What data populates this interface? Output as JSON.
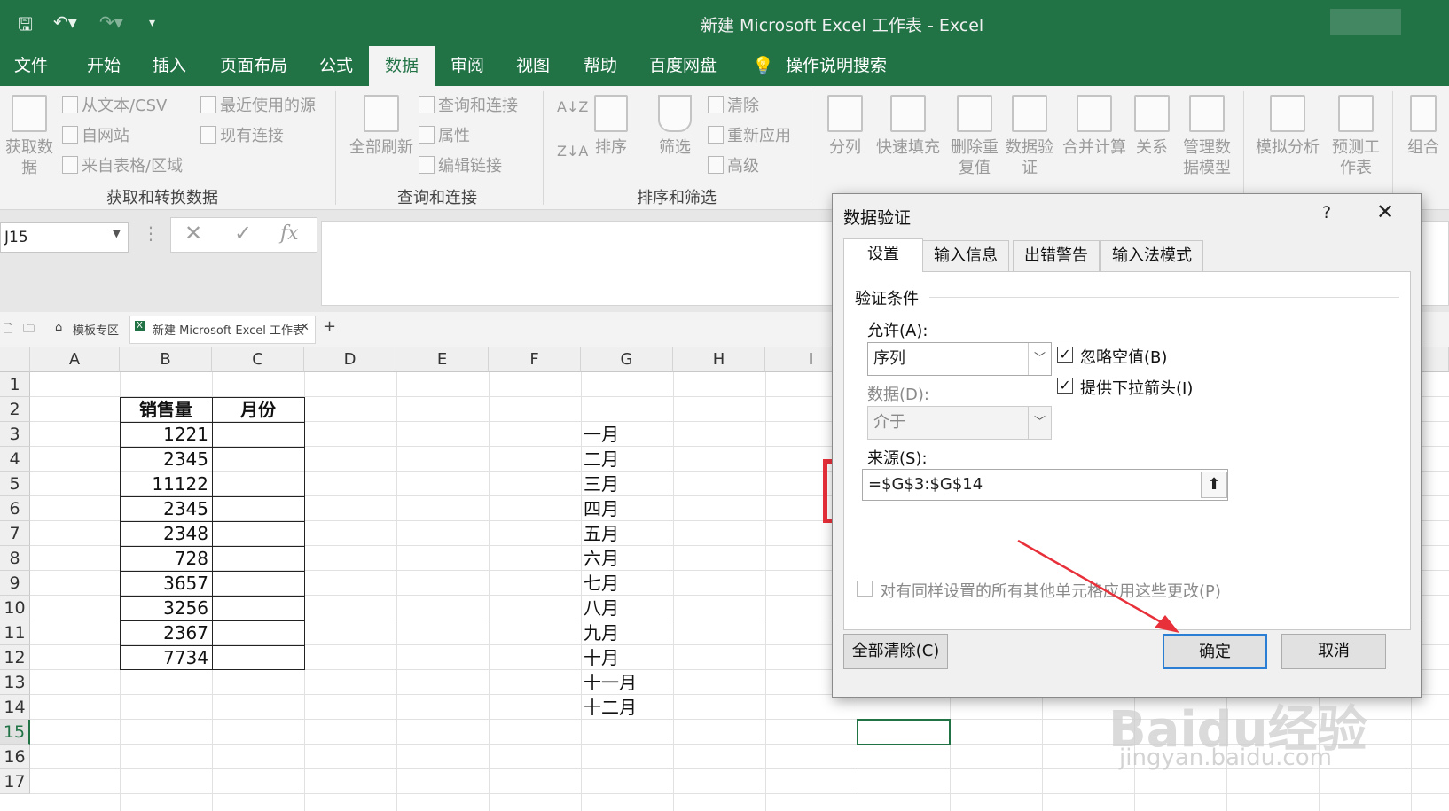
{
  "window": {
    "title": "新建 Microsoft Excel 工作表  -  Excel"
  },
  "ribbon_tabs": [
    "文件",
    "开始",
    "插入",
    "页面布局",
    "公式",
    "数据",
    "审阅",
    "视图",
    "帮助",
    "百度网盘",
    "操作说明搜索"
  ],
  "ribbon": {
    "get_data": "获取数据",
    "from_text": "从文本/CSV",
    "from_web": "自网站",
    "from_table": "来自表格/区域",
    "recent_sources": "最近使用的源",
    "existing_conn": "现有连接",
    "group_get": "获取和转换数据",
    "refresh_all": "全部刷新",
    "queries_conn": "查询和连接",
    "properties": "属性",
    "edit_links": "编辑链接",
    "group_queries": "查询和连接",
    "sort": "排序",
    "filter": "筛选",
    "clear": "清除",
    "reapply": "重新应用",
    "advanced": "高级",
    "group_sort": "排序和筛选",
    "text_to_col": "分列",
    "flash_fill": "快速填充",
    "remove_dup": "删除重复值",
    "data_valid": "数据验证",
    "consolidate": "合并计算",
    "relations": "关系",
    "manage_model": "管理数据模型",
    "what_if": "模拟分析",
    "forecast": "预测工作表",
    "group_label": "组合"
  },
  "formula_bar": {
    "name_box": "J15",
    "cancel": "✕",
    "enter": "✓",
    "fx": "fx",
    "value": ""
  },
  "workbook_tabs": {
    "template": "模板专区",
    "file": "新建 Microsoft Excel 工作表",
    "add": "+"
  },
  "sheet": {
    "columns": [
      "A",
      "B",
      "C",
      "D",
      "E",
      "F",
      "G",
      "H",
      "I"
    ],
    "rows": [
      "1",
      "2",
      "3",
      "4",
      "5",
      "6",
      "7",
      "8",
      "9",
      "10",
      "11",
      "12",
      "13",
      "14",
      "15",
      "16",
      "17"
    ],
    "header_b": "销售量",
    "header_c": "月份",
    "sales": [
      "1221",
      "2345",
      "11122",
      "2345",
      "2348",
      "728",
      "3657",
      "3256",
      "2367",
      "7734"
    ],
    "months": [
      "一月",
      "二月",
      "三月",
      "四月",
      "五月",
      "六月",
      "七月",
      "八月",
      "九月",
      "十月",
      "十一月",
      "十二月"
    ]
  },
  "dialog": {
    "title": "数据验证",
    "help": "?",
    "close": "✕",
    "tabs": [
      "设置",
      "输入信息",
      "出错警告",
      "输入法模式"
    ],
    "section": "验证条件",
    "allow_label": "允许(A):",
    "allow_value": "序列",
    "ignore_blank": "忽略空值(B)",
    "dropdown": "提供下拉箭头(I)",
    "data_label": "数据(D):",
    "data_value": "介于",
    "source_label": "来源(S):",
    "source_value": "=$G$3:$G$14",
    "apply_all": "对有同样设置的所有其他单元格应用这些更改(P)",
    "clear_all": "全部清除(C)",
    "ok": "确定",
    "cancel": "取消"
  },
  "watermark": {
    "brand": "Baidu经验",
    "url": "jingyan.baidu.com"
  },
  "colors": {
    "excel_green": "#217346",
    "annotation_red": "#e8303a"
  }
}
